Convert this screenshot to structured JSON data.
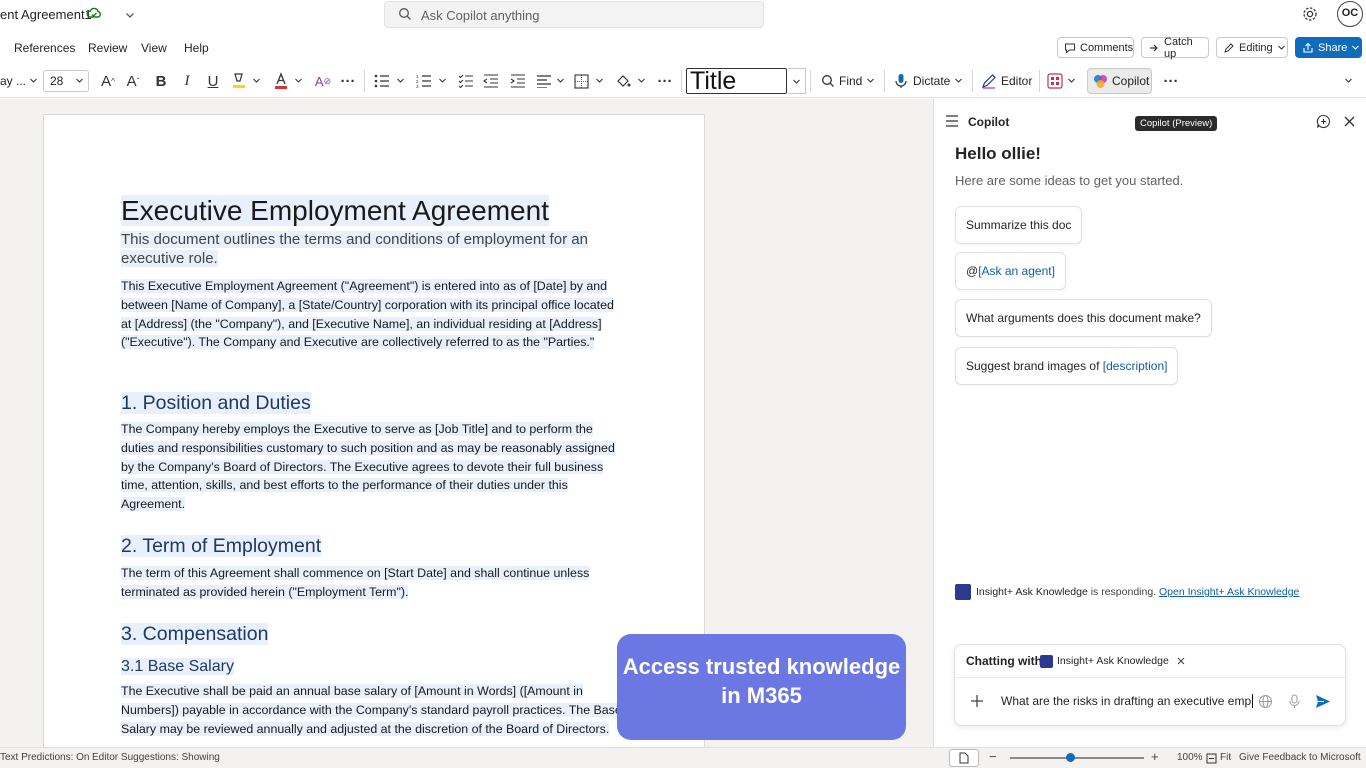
{
  "title_bar": {
    "doc_title": "ent Agreement1",
    "search_placeholder": "Ask Copilot anything",
    "avatar_initials": "OC"
  },
  "menu": {
    "items": [
      "References",
      "Review",
      "View",
      "Help"
    ],
    "comments_label": "Comments",
    "catchup_label": "Catch up",
    "editing_label": "Editing",
    "share_label": "Share"
  },
  "ribbon": {
    "font_name": "ay ...",
    "font_size": "28",
    "style_label": "Title",
    "find_label": "Find",
    "dictate_label": "Dictate",
    "editor_label": "Editor",
    "copilot_label": "Copilot",
    "font_color": "#d13438",
    "highlight_color": "#ffd800"
  },
  "document": {
    "title": "Executive Employment Agreement",
    "subtitle": "This document outlines the terms and conditions of employment for an executive role.",
    "intro": "This Executive Employment Agreement (\"Agreement\") is entered into as of [Date] by and between [Name of Company], a [State/Country] corporation with its principal office located at [Address] (the \"Company\"), and [Executive Name], an individual residing at [Address] (\"Executive\"). The Company and Executive are collectively referred to as the \"Parties.\"",
    "sections": [
      {
        "heading": "1. Position and Duties",
        "body": "The Company hereby employs the Executive to serve as [Job Title] and to perform the duties and responsibilities customary to such position and as may be reasonably assigned by the Company's Board of Directors. The Executive agrees to devote their full business time, attention, skills, and best efforts to the performance of their duties under this Agreement."
      },
      {
        "heading": "2. Term of Employment",
        "body": "The term of this Agreement shall commence on [Start Date] and shall continue unless terminated as provided herein (\"Employment Term\")."
      },
      {
        "heading": "3. Compensation",
        "subheading": "3.1 Base Salary",
        "body": "The Executive shall be paid an annual base salary of [Amount in Words] ([Amount in Numbers]) payable in accordance with the Company's standard payroll practices. The Base Salary may be reviewed annually and adjusted at the discretion of the Board of Directors."
      }
    ]
  },
  "promo_text": "Access trusted knowledge in M365",
  "status_bar": {
    "text_predictions": "Text Predictions: On",
    "editor_suggestions": "Editor Suggestions: Showing",
    "zoom": "100%",
    "fit": "Fit",
    "feedback": "Give Feedback to Microsoft",
    "zoom_level": 0.45
  },
  "copilot_panel": {
    "title": "Copilot",
    "tooltip": "Copilot (Preview)",
    "greeting": "Hello ollie!",
    "ideas_text": "Here are some ideas to get you started.",
    "suggestions": [
      {
        "text": "Summarize this doc",
        "link": ""
      },
      {
        "text": "@",
        "link": "[Ask an agent]"
      },
      {
        "text": "What arguments does this document make?",
        "link": ""
      },
      {
        "text": "Suggest brand images of ",
        "link": "[description]"
      }
    ],
    "responding_agent": "Insight+ Ask Knowledge",
    "responding_text": " is responding. ",
    "responding_link": "Open Insight+ Ask Knowledge",
    "chatting_with": "Chatting with",
    "chip_label": "Insight+ Ask Knowledge",
    "input_value": "What are the risks in drafting an executive employ"
  }
}
